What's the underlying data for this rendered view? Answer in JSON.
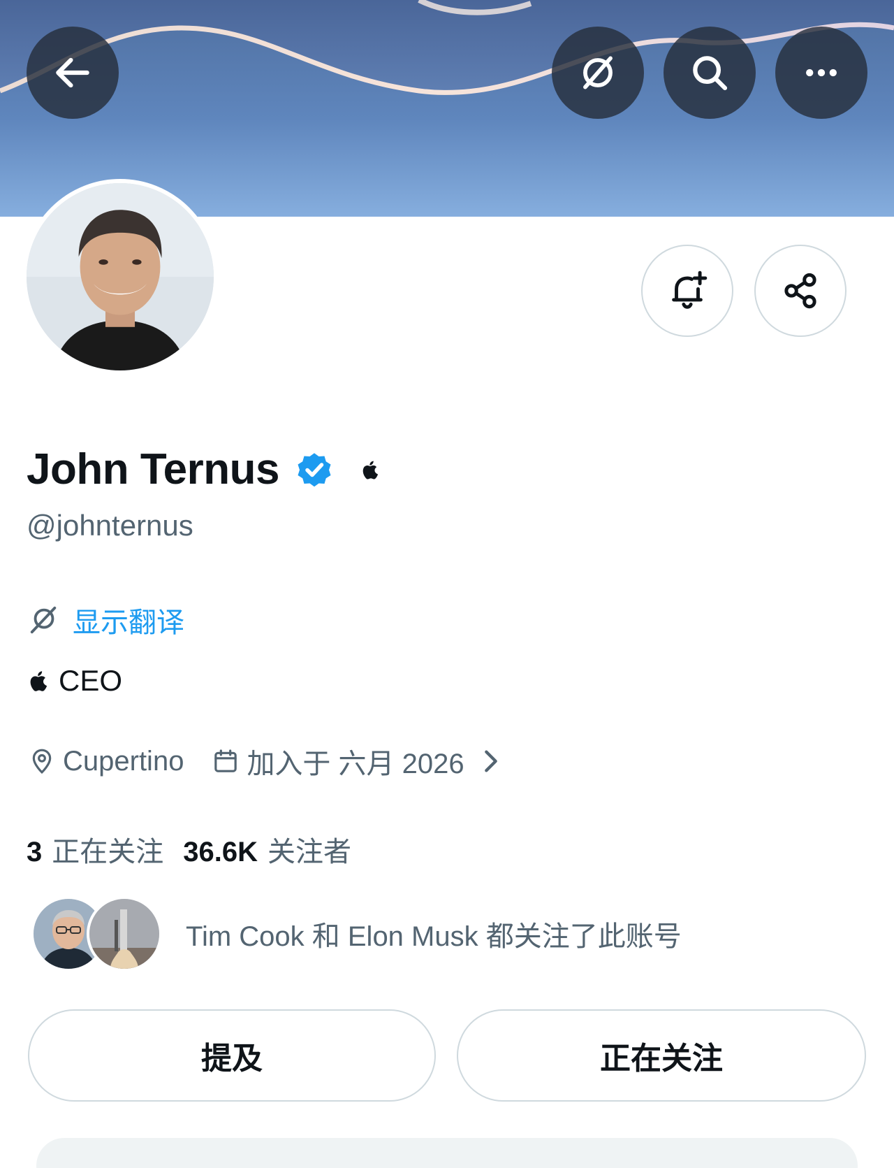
{
  "profile": {
    "display_name": "John Ternus",
    "handle": "@johnternus",
    "bio": "CEO",
    "location": "Cupertino",
    "joined": "加入于 六月 2026"
  },
  "translate": {
    "label": "显示翻译"
  },
  "stats": {
    "following_count": "3",
    "following_label": "正在关注",
    "followers_count": "36.6K",
    "followers_label": "关注者"
  },
  "followed_by": {
    "text": "Tim Cook 和 Elon Musk 都关注了此账号"
  },
  "actions": {
    "mention_label": "提及",
    "following_label": "正在关注"
  },
  "header_buttons": [
    "back-arrow-icon",
    "translate-icon",
    "search-icon",
    "more-icon"
  ],
  "profile_buttons": [
    "bell-plus-icon",
    "share-icon"
  ],
  "colors": {
    "accent": "#1d9bf0",
    "verified": "#1d9bf0",
    "secondary_text": "#536471"
  }
}
